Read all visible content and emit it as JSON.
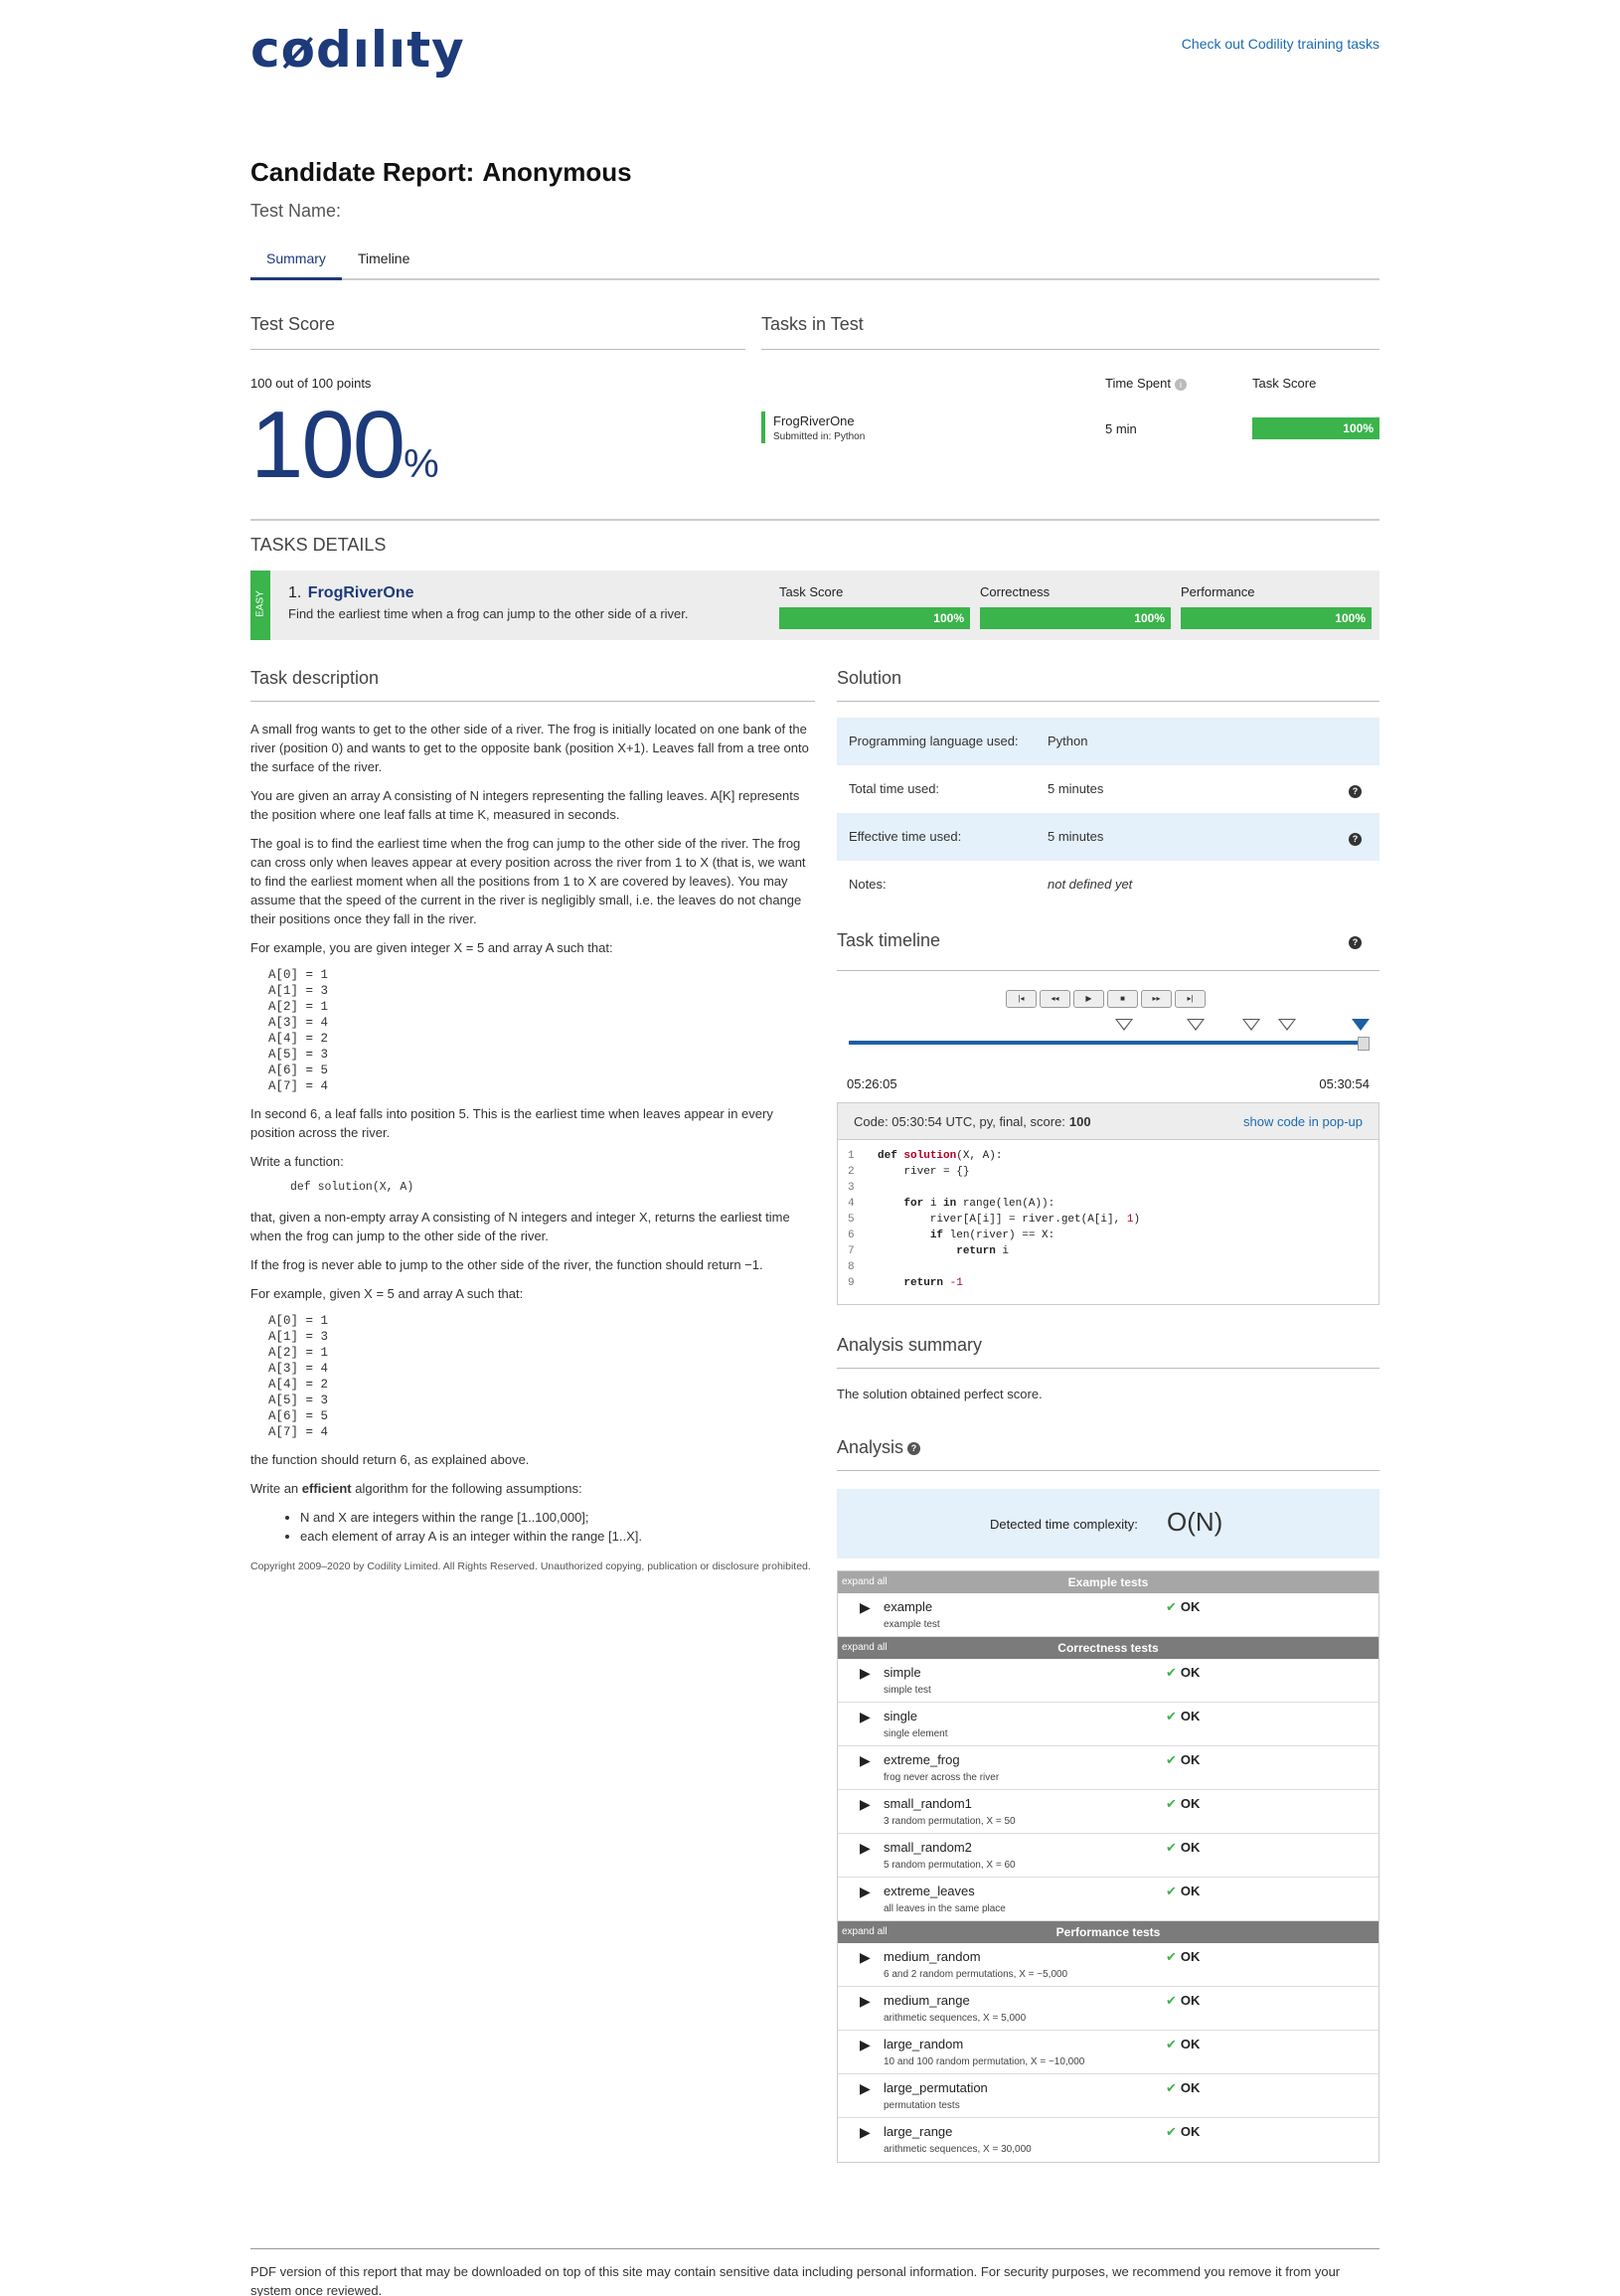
{
  "header": {
    "logo": "cødılıty",
    "training_link": "Check out Codility training tasks"
  },
  "report": {
    "title_label": "Candidate Report:",
    "candidate": "Anonymous",
    "test_name_label": "Test Name:"
  },
  "tabs": [
    {
      "label": "Summary",
      "active": true
    },
    {
      "label": "Timeline",
      "active": false
    }
  ],
  "test_score": {
    "heading": "Test Score",
    "points": "100 out of 100 points",
    "percent": "100",
    "percent_sign": "%"
  },
  "tasks_in_test": {
    "heading": "Tasks in Test",
    "col_time": "Time Spent",
    "col_score": "Task Score",
    "task": {
      "name": "FrogRiverOne",
      "submitted": "Submitted in: Python",
      "time": "5 min",
      "score": "100%",
      "score_fraction": 1.0
    }
  },
  "tasks_details": {
    "heading": "TASKS DETAILS",
    "difficulty": "EASY",
    "number": "1.",
    "name": "FrogRiverOne",
    "description": "Find the earliest time when a frog can jump to the other side of a river.",
    "metrics": [
      {
        "label": "Task Score",
        "value": "100%",
        "fraction": 1.0
      },
      {
        "label": "Correctness",
        "value": "100%",
        "fraction": 1.0
      },
      {
        "label": "Performance",
        "value": "100%",
        "fraction": 1.0
      }
    ]
  },
  "task_description": {
    "heading": "Task description",
    "p1": "A small frog wants to get to the other side of a river. The frog is initially located on one bank of the river (position 0) and wants to get to the opposite bank (position X+1). Leaves fall from a tree onto the surface of the river.",
    "p2": "You are given an array A consisting of N integers representing the falling leaves. A[K] represents the position where one leaf falls at time K, measured in seconds.",
    "p3": "The goal is to find the earliest time when the frog can jump to the other side of the river. The frog can cross only when leaves appear at every position across the river from 1 to X (that is, we want to find the earliest moment when all the positions from 1 to X are covered by leaves). You may assume that the speed of the current in the river is negligibly small, i.e. the leaves do not change their positions once they fall in the river.",
    "p4": "For example, you are given integer X = 5 and array A such that:",
    "array1": "A[0] = 1\nA[1] = 3\nA[2] = 1\nA[3] = 4\nA[4] = 2\nA[5] = 3\nA[6] = 5\nA[7] = 4",
    "p5": "In second 6, a leaf falls into position 5. This is the earliest time when leaves appear in every position across the river.",
    "p6": "Write a function:",
    "signature": "def solution(X, A)",
    "p7": "that, given a non-empty array A consisting of N integers and integer X, returns the earliest time when the frog can jump to the other side of the river.",
    "p8": "If the frog is never able to jump to the other side of the river, the function should return −1.",
    "p9": "For example, given X = 5 and array A such that:",
    "array2": "A[0] = 1\nA[1] = 3\nA[2] = 1\nA[3] = 4\nA[4] = 2\nA[5] = 3\nA[6] = 5\nA[7] = 4",
    "p10": "the function should return 6, as explained above.",
    "p11_pre": "Write an ",
    "p11_bold": "efficient",
    "p11_post": " algorithm for the following assumptions:",
    "assumptions": [
      "N and X are integers within the range [1..100,000];",
      "each element of array A is an integer within the range [1..X]."
    ],
    "copyright": "Copyright 2009–2020 by Codility Limited. All Rights Reserved. Unauthorized copying, publication or disclosure prohibited."
  },
  "solution": {
    "heading": "Solution",
    "rows": [
      {
        "key": "Programming language used:",
        "value": "Python"
      },
      {
        "key": "Total time used:",
        "value": "5 minutes"
      },
      {
        "key": "Effective time used:",
        "value": "5 minutes"
      },
      {
        "key": "Notes:",
        "value": "not defined yet"
      }
    ]
  },
  "timeline": {
    "heading": "Task timeline",
    "buttons": [
      "|◂",
      "◂◂",
      "▶",
      "■",
      "▸▸",
      "▸|"
    ],
    "start": "05:26:05",
    "end": "05:30:54"
  },
  "code": {
    "label": "Code: 05:30:54 UTC, py, final, score:",
    "score": "100",
    "popup_link": "show code in pop-up"
  },
  "analysis_summary": {
    "heading": "Analysis summary",
    "text": "The solution obtained perfect score."
  },
  "analysis": {
    "heading": "Analysis",
    "complexity_label": "Detected time complexity:",
    "complexity": "O(N)",
    "expand_all": "expand all",
    "groups": [
      {
        "title": "Example tests",
        "tests": [
          {
            "name": "example",
            "sub": "example test",
            "result": "OK"
          }
        ]
      },
      {
        "title": "Correctness tests",
        "tests": [
          {
            "name": "simple",
            "sub": "simple test",
            "result": "OK"
          },
          {
            "name": "single",
            "sub": "single element",
            "result": "OK"
          },
          {
            "name": "extreme_frog",
            "sub": "frog never across the river",
            "result": "OK"
          },
          {
            "name": "small_random1",
            "sub": "3 random permutation, X = 50",
            "result": "OK"
          },
          {
            "name": "small_random2",
            "sub": "5 random permutation, X = 60",
            "result": "OK"
          },
          {
            "name": "extreme_leaves",
            "sub": "all leaves in the same place",
            "result": "OK"
          }
        ]
      },
      {
        "title": "Performance tests",
        "tests": [
          {
            "name": "medium_random",
            "sub": "6 and 2 random permutations, X = ~5,000",
            "result": "OK"
          },
          {
            "name": "medium_range",
            "sub": "arithmetic sequences, X = 5,000",
            "result": "OK"
          },
          {
            "name": "large_random",
            "sub": "10 and 100 random permutation, X = ~10,000",
            "result": "OK"
          },
          {
            "name": "large_permutation",
            "sub": "permutation tests",
            "result": "OK"
          },
          {
            "name": "large_range",
            "sub": "arithmetic sequences, X = 30,000",
            "result": "OK"
          }
        ]
      }
    ]
  },
  "footer": {
    "text": "PDF version of this report that may be downloaded on top of this site may contain sensitive data including personal information. For security purposes, we recommend you remove it from your system once reviewed."
  }
}
